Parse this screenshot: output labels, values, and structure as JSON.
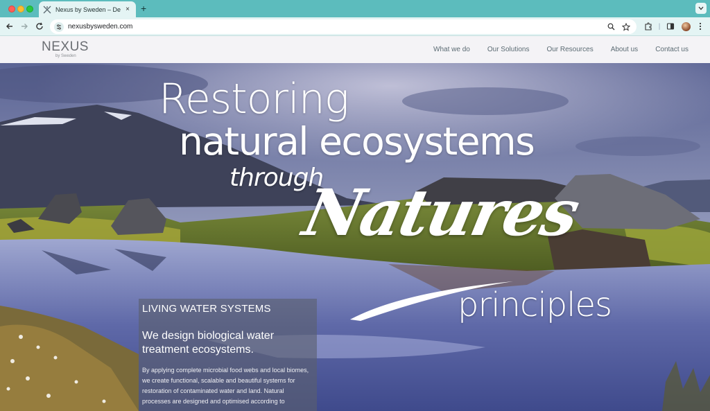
{
  "browser": {
    "tab_title": "Nexus by Sweden – Decentra",
    "tab_close": "×",
    "new_tab": "+",
    "url": "nexusbysweden.com"
  },
  "site": {
    "logo_main": "NEXUS",
    "logo_sub": "by Sweden",
    "nav": [
      "What we do",
      "Our Solutions",
      "Our Resources",
      "About us",
      "Contact us"
    ]
  },
  "hero": {
    "line1": "Restoring",
    "line2": "natural ecosystems",
    "line3": "through",
    "line4": "Natures",
    "line5": "principles"
  },
  "panel": {
    "kicker": "LIVING WATER SYSTEMS",
    "heading": "We design biological water treatment ecosystems.",
    "body": "By applying complete microbial food webs and local biomes, we create functional, scalable and beautiful systems for restoration of contaminated water and land. Natural processes are designed and optimised according to"
  },
  "colors": {
    "chrome_tab_strip": "#5cbcbd",
    "chrome_toolbar": "#e4f4f4",
    "header_bg": "#f4f3f6",
    "nav_text": "#5b6b73",
    "panel_bg": "rgba(90,95,110,0.62)"
  }
}
